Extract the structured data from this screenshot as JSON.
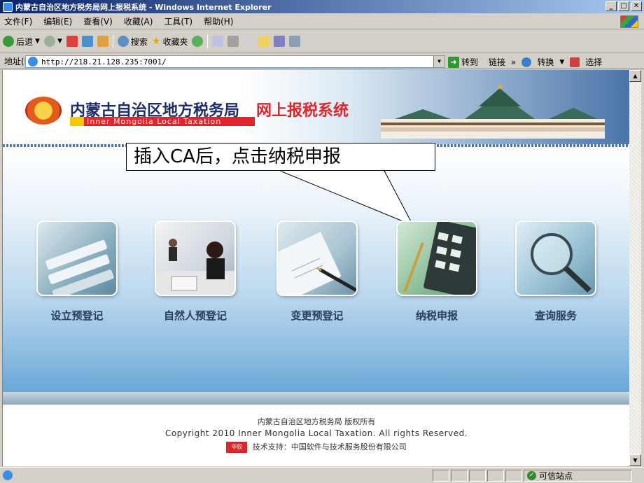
{
  "window": {
    "title": "内蒙古自治区地方税务局网上报税系统 - Windows Internet Explorer",
    "minimize": "_",
    "maximize": "□",
    "close": "✕"
  },
  "menu": [
    "文件(F)",
    "编辑(E)",
    "查看(V)",
    "收藏(A)",
    "工具(T)",
    "帮助(H)"
  ],
  "toolbar": {
    "back": "后退",
    "search": "搜索",
    "favorites": "收藏夹"
  },
  "address": {
    "label": "地址(D)",
    "url": "http://218.21.128.235:7001/",
    "go": "转到",
    "links": "链接",
    "links_more": "»",
    "convert": "转换",
    "select": "选择"
  },
  "page": {
    "brand_cn": "内蒙古自治区地方税务局",
    "brand_highlight": "网上报税系统",
    "brand_en": "Inner Mongolia Local Taxation",
    "callout": "插入CA后，点击纳税申报",
    "tiles": [
      {
        "label": "设立预登记"
      },
      {
        "label": "自然人预登记"
      },
      {
        "label": "变更预登记"
      },
      {
        "label": "纳税申报"
      },
      {
        "label": "查询服务"
      }
    ],
    "footer": {
      "copyright_cn": "内蒙古自治区地方税务局  版权所有",
      "copyright_en": "Copyright 2010 Inner Mongolia Local Taxation. All rights Reserved.",
      "support": "技术支持：中国软件与技术服务股份有限公司",
      "logo_text": "中软 CSSS"
    }
  },
  "status": {
    "zone": "可信站点"
  }
}
